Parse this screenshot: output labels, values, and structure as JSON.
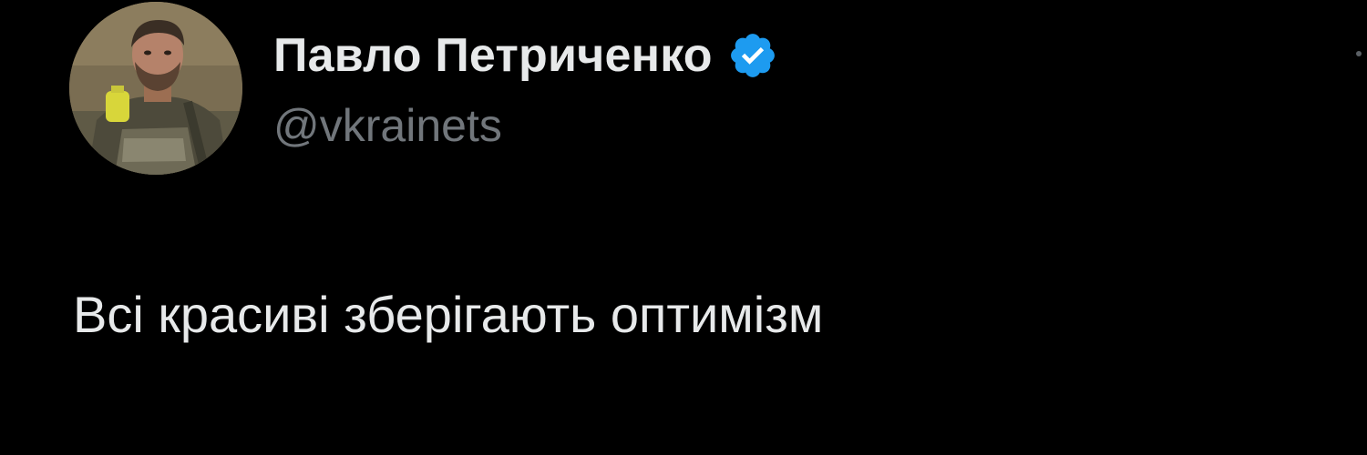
{
  "author": {
    "display_name": "Павло Петриченко",
    "handle": "@vkrainets",
    "verified": true
  },
  "tweet": {
    "text": "Всі красиві зберігають оптимізм"
  },
  "icons": {
    "verified": "verified-badge-icon",
    "more": "more-options-icon"
  },
  "colors": {
    "background": "#000000",
    "name": "#e7e9ea",
    "handle": "#71767b",
    "verified_badge": "#1d9bf0"
  }
}
